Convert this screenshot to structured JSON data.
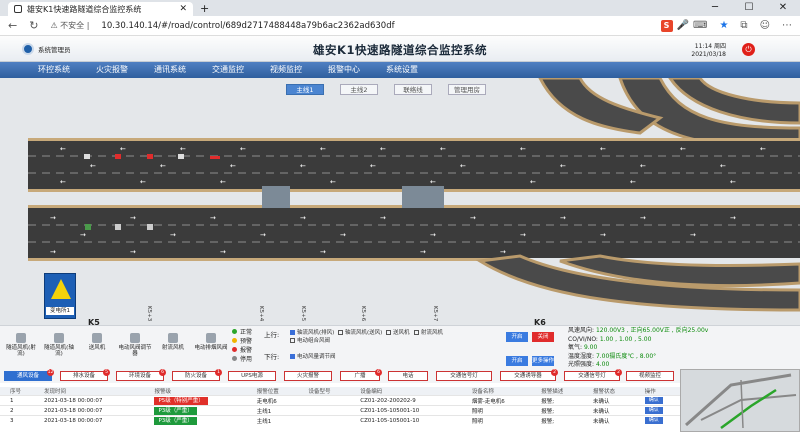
{
  "browser": {
    "tab_title": "雄安K1快速路隧道综合监控系统",
    "url": "10.30.140.14/#/road/control/689d2717488448a79b6ac2362ad630df",
    "security": "不安全"
  },
  "app": {
    "system_label": "系统管理员",
    "title": "雄安K1快速路隧道综合监控系统",
    "clock_time": "11:14 周四",
    "clock_date": "2021/03/18"
  },
  "nav": [
    "环控系统",
    "火灾报警",
    "通讯系统",
    "交通监控",
    "视频监控",
    "报警中心",
    "系统设置"
  ],
  "subtabs": [
    "主线1",
    "主线2",
    "联络线",
    "管理用房"
  ],
  "map": {
    "k5": "K5",
    "k6": "K6",
    "kmarks": [
      "K5+3",
      "K5+4",
      "K5+5",
      "K5+6",
      "K5+7"
    ],
    "substation": "变电所1"
  },
  "devices": [
    "隧道风机(射流)",
    "隧道风机(轴流)",
    "送风机",
    "电动风阀调节器",
    "射流风机",
    "电动排烟风阀"
  ],
  "legend": [
    "正常",
    "预警",
    "报警",
    "停用"
  ],
  "legend_colors": [
    "#2aa52a",
    "#f0b400",
    "#e02c2c",
    "#888888"
  ],
  "controls": {
    "up": "上行:",
    "down": "下行:",
    "up_checks": [
      "轴流风机(排风)",
      "轴流风机(送风)",
      "送风机",
      "射流风机"
    ],
    "up_checks2": [
      "电动组合风阀"
    ],
    "down_checks": [
      "电动风量调节阀"
    ],
    "btn_open": "开启",
    "btn_close": "关闭",
    "btn_open2": "开启",
    "btn_more": "更多操作"
  },
  "env": {
    "wind_label": "风速风向:",
    "wind_val": "120.00V3 , 正向65.00V正 , 反向25.00v",
    "co_label": "CO/VI/NO:",
    "co_val": "1.00 , 1.00 , 5.00",
    "o2_label": "氧气:",
    "o2_val": "9.00",
    "temp_label": "温度湿度:",
    "temp_val": "7.00摄氏度℃ , 8.00°",
    "light_label": "光照强度:",
    "light_val": "4.00"
  },
  "cats": [
    {
      "label": "通风设备",
      "count": "12"
    },
    {
      "label": "排水设备",
      "count": "5"
    },
    {
      "label": "环境设备",
      "count": "6"
    },
    {
      "label": "防火设备",
      "count": "1"
    },
    {
      "label": "UPS电源",
      "count": ""
    },
    {
      "label": "火灾报警",
      "count": ""
    },
    {
      "label": "广播",
      "count": "6"
    },
    {
      "label": "电话",
      "count": ""
    },
    {
      "label": "交通信号灯",
      "count": ""
    },
    {
      "label": "交通诱导器",
      "count": "2"
    },
    {
      "label": "交通信号灯",
      "count": "2"
    },
    {
      "label": "视频监控",
      "count": ""
    }
  ],
  "table": {
    "headers": [
      "序号",
      "发现时间",
      "报警级",
      "报警位置",
      "设备型号",
      "设备编码",
      "设备名称",
      "报警描述",
      "报警状态",
      "操作"
    ],
    "rows": [
      [
        "1",
        "2021-03-18 00:00:07",
        "P5级（特别严重）",
        "走电机6",
        "",
        "CZ01-202-200202-9",
        "烟雾-走电机6",
        "报警;",
        "未确认",
        "确认"
      ],
      [
        "2",
        "2021-03-18 00:00:07",
        "P3级（严重）",
        "主线1",
        "",
        "CZ01-105-105001-10",
        "照明",
        "报警;",
        "未确认",
        "确认"
      ],
      [
        "3",
        "2021-03-18 00:00:07",
        "P3级（严重）",
        "主线1",
        "",
        "CZ01-105-105001-10",
        "照明",
        "报警;",
        "未确认",
        "确认"
      ]
    ],
    "level_colors": [
      "#e0302a",
      "#1e9a3c",
      "#1e9a3c"
    ]
  }
}
